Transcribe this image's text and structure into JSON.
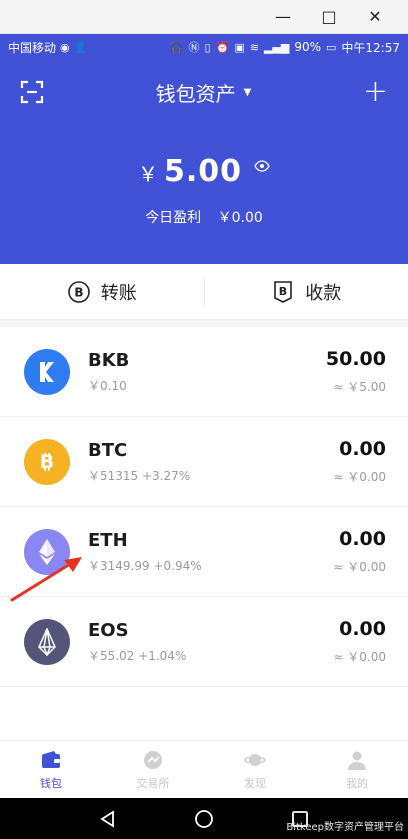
{
  "window_controls": {
    "minimize": "—",
    "maximize": "□",
    "close": "✕"
  },
  "status_bar": {
    "carrier": "中国移动",
    "battery": "90%",
    "time": "中午12:57"
  },
  "header": {
    "title": "钱包资产",
    "currency_symbol": "￥",
    "balance": "5.00",
    "profit_label": "今日盈利",
    "profit_value": "￥0.00"
  },
  "actions": {
    "transfer": "转账",
    "receive": "收款"
  },
  "assets": [
    {
      "symbol": "BKB",
      "price": "￥0.10",
      "amount": "50.00",
      "fiat": "≈ ￥5.00",
      "icon": "bkb-icon",
      "color": "#2f7bf0"
    },
    {
      "symbol": "BTC",
      "price": "￥51315 +3.27%",
      "amount": "0.00",
      "fiat": "≈ ￥0.00",
      "icon": "bitcoin-icon",
      "color": "#f7b125"
    },
    {
      "symbol": "ETH",
      "price": "￥3149.99 +0.94%",
      "amount": "0.00",
      "fiat": "≈ ￥0.00",
      "icon": "ethereum-icon",
      "color": "#8a87f4"
    },
    {
      "symbol": "EOS",
      "price": "￥55.02 +1.04%",
      "amount": "0.00",
      "fiat": "≈ ￥0.00",
      "icon": "eos-icon",
      "color": "#55557a"
    }
  ],
  "tabs": [
    {
      "label": "钱包",
      "active": true
    },
    {
      "label": "交易所",
      "active": false
    },
    {
      "label": "发现",
      "active": false
    },
    {
      "label": "我的",
      "active": false
    }
  ],
  "watermark": "Bitkeep数字资产管理平台",
  "colors": {
    "primary": "#4252d6",
    "annotation_arrow": "#e53323"
  }
}
